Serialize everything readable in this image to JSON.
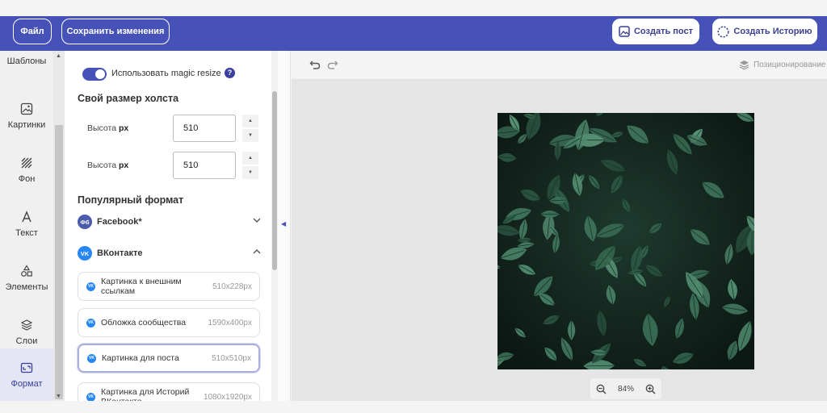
{
  "topbar": {
    "file_label": "Файл",
    "save_label": "Сохранить изменения",
    "create_post_label": "Создать пост",
    "create_story_label": "Создать Историю"
  },
  "leftnav": {
    "items": [
      {
        "label": "Шаблоны",
        "icon": "templates-icon"
      },
      {
        "label": "Картинки",
        "icon": "image-icon"
      },
      {
        "label": "Фон",
        "icon": "background-icon"
      },
      {
        "label": "Текст",
        "icon": "text-icon"
      },
      {
        "label": "Элементы",
        "icon": "elements-icon"
      },
      {
        "label": "Слои",
        "icon": "layers-icon"
      },
      {
        "label": "Формат",
        "icon": "format-icon",
        "active": true
      }
    ]
  },
  "panel": {
    "magic_resize_label": "Использовать magic resize",
    "magic_resize_on": true,
    "help_glyph": "?",
    "custom_size_title": "Свой размер холста",
    "height_label_1": "Высота",
    "width_label": "Высота",
    "unit": "px",
    "height_value": "510",
    "width_value": "510",
    "popular_title": "Популярный формат",
    "facebook": {
      "badge": "Фб",
      "label": "Facebook*",
      "expanded": false
    },
    "vk": {
      "badge": "VK",
      "label": "ВКонтакте",
      "expanded": true
    },
    "formats": [
      {
        "name": "Картинка к внешним ссылкам",
        "dims": "510x228px",
        "selected": false
      },
      {
        "name": "Обложка сообщества",
        "dims": "1590x400px",
        "selected": false
      },
      {
        "name": "Картинка для поста",
        "dims": "510x510px",
        "selected": true
      },
      {
        "name": "Картинка для Историй ВКонтакте",
        "dims": "1080x1920px",
        "selected": false
      }
    ]
  },
  "workspace": {
    "positioning_label": "Позиционирование",
    "zoom_level": "84%"
  },
  "colors": {
    "accent": "#4652b8",
    "vk_blue": "#2787f5",
    "facebook": "#4a5cab"
  }
}
